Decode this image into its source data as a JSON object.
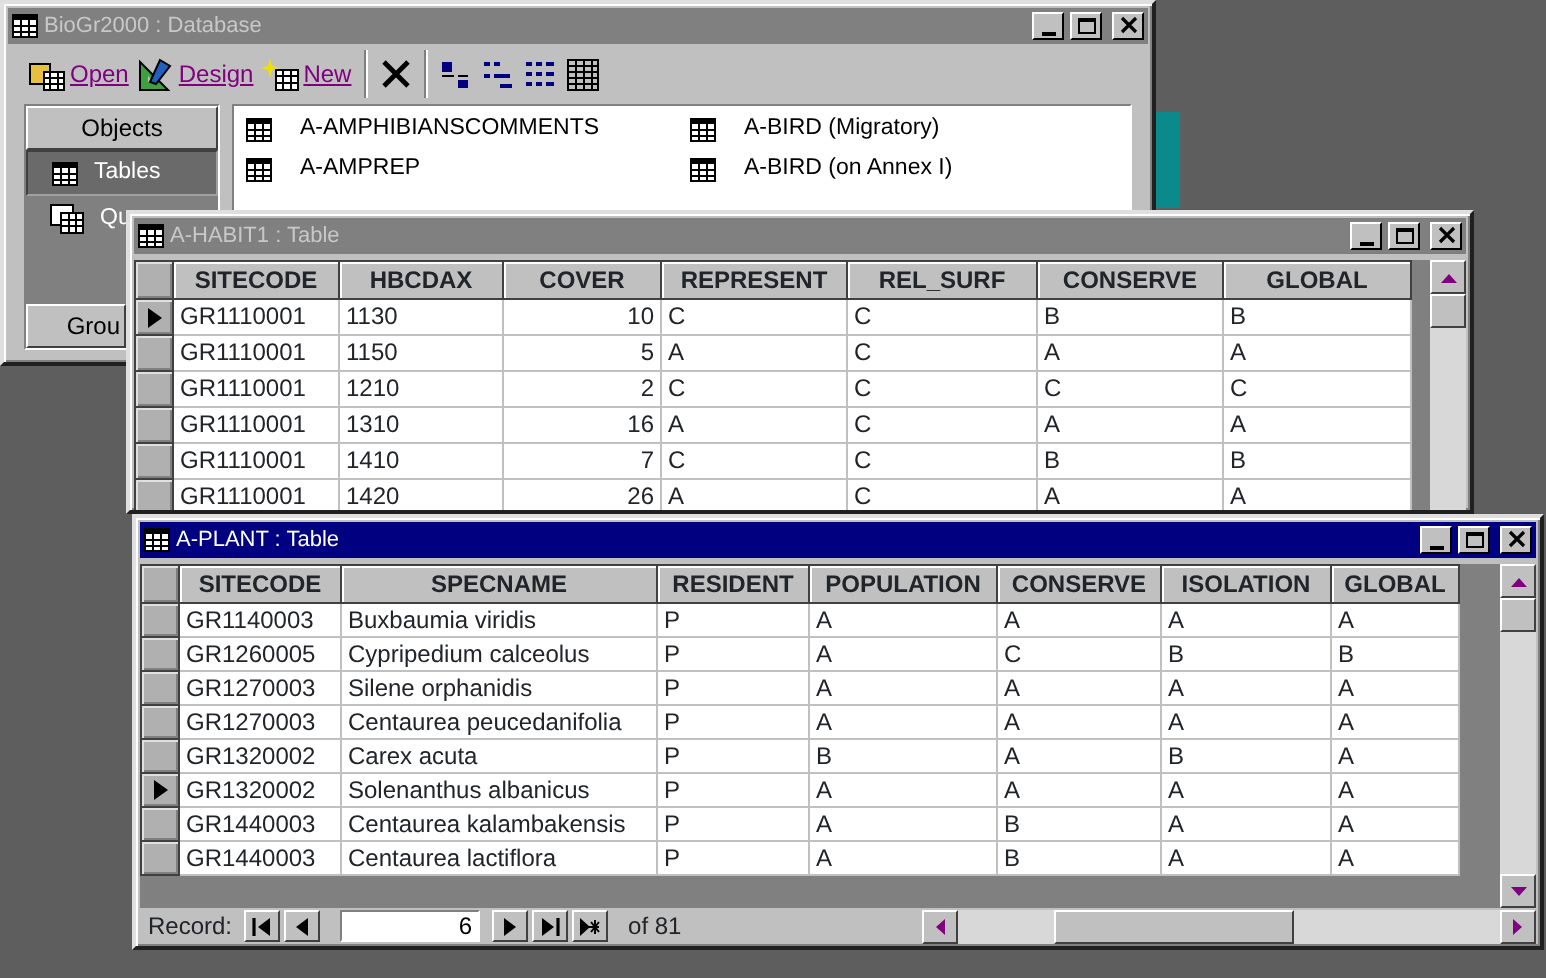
{
  "database_window": {
    "title": "BioGr2000 : Database",
    "active": false,
    "toolbar": [
      {
        "label": "Open",
        "kind": "open"
      },
      {
        "label": "Design",
        "kind": "design"
      },
      {
        "label": "New",
        "kind": "new"
      }
    ],
    "objects_header": "Objects",
    "object_types": [
      {
        "label": "Tables",
        "kind": "table",
        "selected": true
      },
      {
        "label": "Qu",
        "kind": "query",
        "selected": false
      }
    ],
    "groups_button": "Grou",
    "items": [
      "A-AMPHIBIANSCOMMENTS",
      "A-BIRD (Migratory)",
      "A-AMPREP",
      "A-BIRD (on Annex I)"
    ]
  },
  "habitat_window": {
    "title": "A-HABIT1 : Table",
    "active": false,
    "columns": [
      {
        "label": "SITECODE",
        "right_aligned": false
      },
      {
        "label": "HBCDAX",
        "right_aligned": false
      },
      {
        "label": "COVER",
        "right_aligned": true
      },
      {
        "label": "REPRESENT",
        "right_aligned": false
      },
      {
        "label": "REL_SURF",
        "right_aligned": false
      },
      {
        "label": "CONSERVE",
        "right_aligned": false
      },
      {
        "label": "GLOBAL",
        "right_aligned": false
      }
    ],
    "rows": [
      {
        "selected": true,
        "cells": [
          "GR1110001",
          "1130",
          "10",
          "C",
          "C",
          "B",
          "B"
        ]
      },
      {
        "selected": false,
        "cells": [
          "GR1110001",
          "1150",
          "5",
          "A",
          "C",
          "A",
          "A"
        ]
      },
      {
        "selected": false,
        "cells": [
          "GR1110001",
          "1210",
          "2",
          "C",
          "C",
          "C",
          "C"
        ]
      },
      {
        "selected": false,
        "cells": [
          "GR1110001",
          "1310",
          "16",
          "A",
          "C",
          "A",
          "A"
        ]
      },
      {
        "selected": false,
        "cells": [
          "GR1110001",
          "1410",
          "7",
          "C",
          "C",
          "B",
          "B"
        ]
      },
      {
        "selected": false,
        "cells": [
          "GR1110001",
          "1420",
          "26",
          "A",
          "C",
          "A",
          "A"
        ]
      }
    ]
  },
  "plant_window": {
    "title": "A-PLANT : Table",
    "active": true,
    "columns": [
      {
        "label": "SITECODE",
        "right_aligned": false
      },
      {
        "label": "SPECNAME",
        "right_aligned": false
      },
      {
        "label": "RESIDENT",
        "right_aligned": false
      },
      {
        "label": "POPULATION",
        "right_aligned": false
      },
      {
        "label": "CONSERVE",
        "right_aligned": false
      },
      {
        "label": "ISOLATION",
        "right_aligned": false
      },
      {
        "label": "GLOBAL",
        "right_aligned": false
      }
    ],
    "rows": [
      {
        "selected": false,
        "cells": [
          "GR1140003",
          "Buxbaumia viridis",
          "P",
          "A",
          "A",
          "A",
          "A"
        ]
      },
      {
        "selected": false,
        "cells": [
          "GR1260005",
          "Cypripedium calceolus",
          "P",
          "A",
          "C",
          "B",
          "B"
        ]
      },
      {
        "selected": false,
        "cells": [
          "GR1270003",
          "Silene orphanidis",
          "P",
          "A",
          "A",
          "A",
          "A"
        ]
      },
      {
        "selected": false,
        "cells": [
          "GR1270003",
          "Centaurea peucedanifolia",
          "P",
          "A",
          "A",
          "A",
          "A"
        ]
      },
      {
        "selected": false,
        "cells": [
          "GR1320002",
          "Carex acuta",
          "P",
          "B",
          "A",
          "B",
          "A"
        ]
      },
      {
        "selected": true,
        "cells": [
          "GR1320002",
          "Solenanthus albanicus",
          "P",
          "A",
          "A",
          "A",
          "A"
        ]
      },
      {
        "selected": false,
        "cells": [
          "GR1440003",
          "Centaurea kalambakensis",
          "P",
          "A",
          "B",
          "A",
          "A"
        ]
      },
      {
        "selected": false,
        "cells": [
          "GR1440003",
          "Centaurea lactiflora",
          "P",
          "A",
          "B",
          "A",
          "A"
        ]
      }
    ],
    "record_bar": {
      "label": "Record:",
      "current": "6",
      "total": "of 81"
    }
  }
}
